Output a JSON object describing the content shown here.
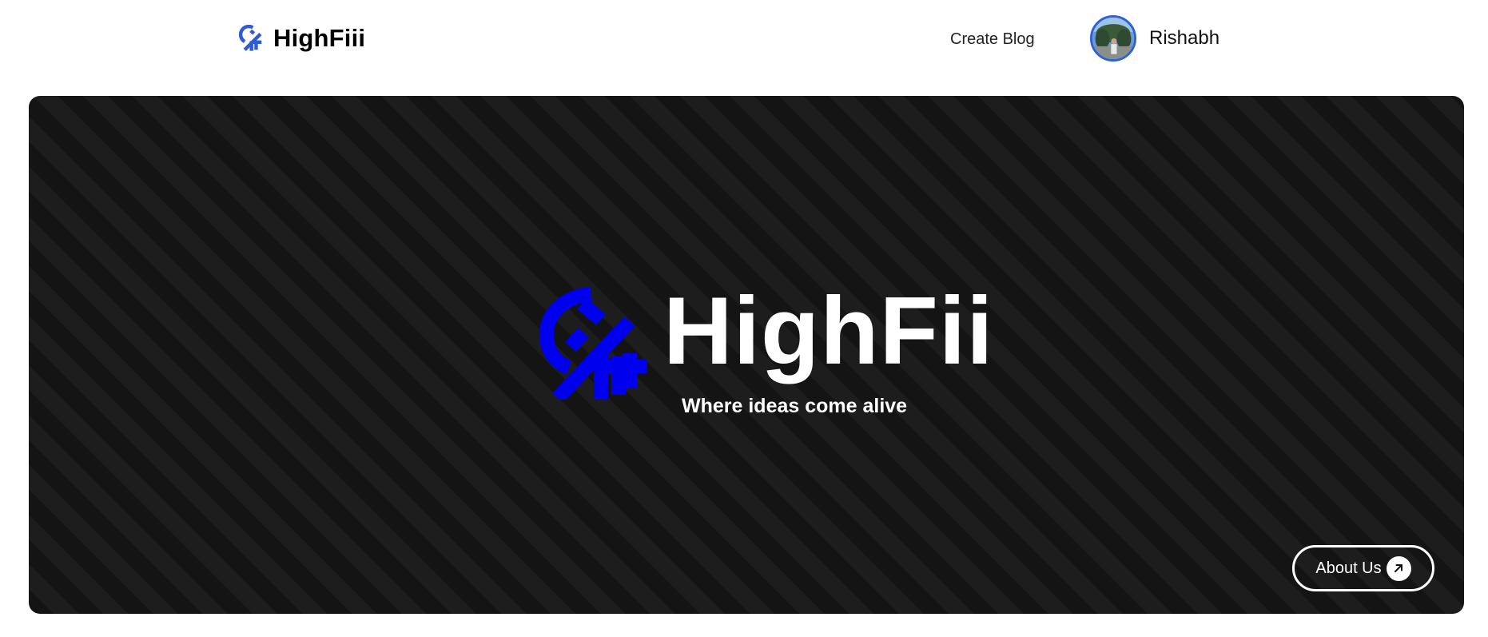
{
  "nav": {
    "brand_name": "HighFiii",
    "brand_icon": "highfii-logo-icon",
    "create_blog_label": "Create Blog",
    "user_name": "Rishabh",
    "avatar_icon": "user-avatar",
    "avatar_ring_color": "#2c62d6"
  },
  "hero": {
    "title": "HighFii",
    "tagline": "Where ideas come alive",
    "logo_icon": "highfii-logo-icon",
    "logo_color": "#0000ee",
    "background_color": "#141414",
    "about_button_label": "About Us",
    "about_button_icon": "arrow-up-right-icon"
  }
}
